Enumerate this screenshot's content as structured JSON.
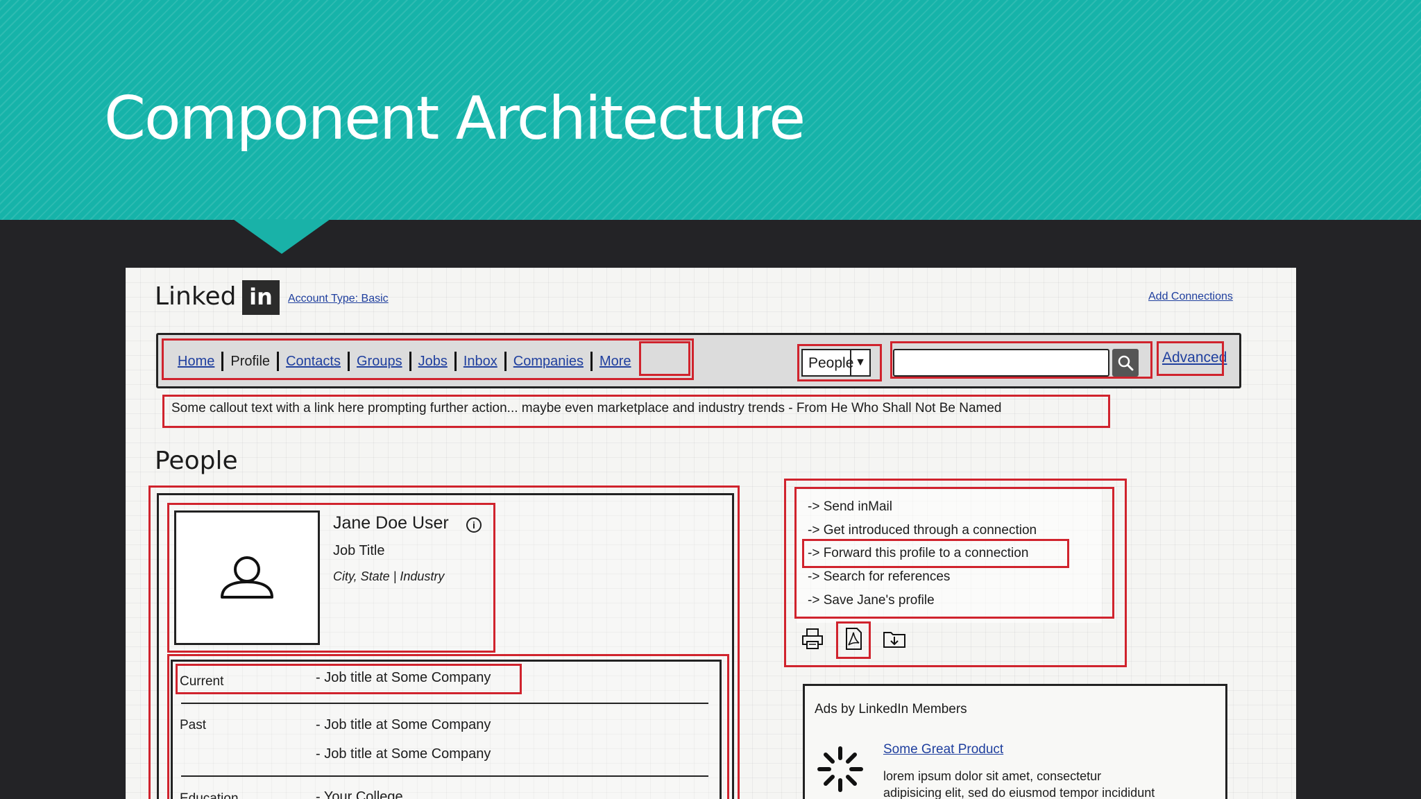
{
  "slide": {
    "title": "Component Architecture"
  },
  "brand": {
    "logo_text": "Linked",
    "logo_badge": "in"
  },
  "header": {
    "account_type": "Account Type: Basic",
    "add_connections": "Add Connections"
  },
  "nav": {
    "items": [
      {
        "label": "Home",
        "link": true
      },
      {
        "label": "Profile",
        "link": false
      },
      {
        "label": "Contacts",
        "link": true
      },
      {
        "label": "Groups",
        "link": true
      },
      {
        "label": "Jobs",
        "link": true
      },
      {
        "label": "Inbox",
        "link": true
      },
      {
        "label": "Companies",
        "link": true
      },
      {
        "label": "More",
        "link": true
      }
    ]
  },
  "search": {
    "scope": "People",
    "query": "",
    "advanced": "Advanced"
  },
  "callout": {
    "text": "Some callout text with a link here prompting further action... maybe even marketplace and industry trends - From He Who Shall Not Be Named"
  },
  "page": {
    "heading": "People"
  },
  "profile": {
    "name": "Jane Doe User",
    "job_title": "Job Title",
    "location": "City, State | Industry",
    "current_label": "Current",
    "current_value": "- Job title at Some Company",
    "past_label": "Past",
    "past_values": [
      "- Job title at Some Company",
      "- Job title at Some Company"
    ],
    "education_label": "Education",
    "education_value": "- Your College"
  },
  "actions": {
    "items": [
      "-> Send inMail",
      "-> Get introduced through a connection",
      "-> Forward this profile to a connection",
      "-> Search for references",
      "-> Save Jane's profile"
    ],
    "icons": [
      "printer-icon",
      "pdf-icon",
      "download-icon"
    ]
  },
  "ads": {
    "title": "Ads by LinkedIn Members",
    "product": "Some Great Product",
    "body_line1": "lorem ipsum dolor sit amet, consectetur",
    "body_line2": "adipisicing elit, sed do eiusmod tempor incididunt"
  },
  "colors": {
    "header_teal": "#16b3a9",
    "background": "#232326",
    "annotation_red": "#d0232d",
    "link_blue": "#1f3f9e"
  }
}
